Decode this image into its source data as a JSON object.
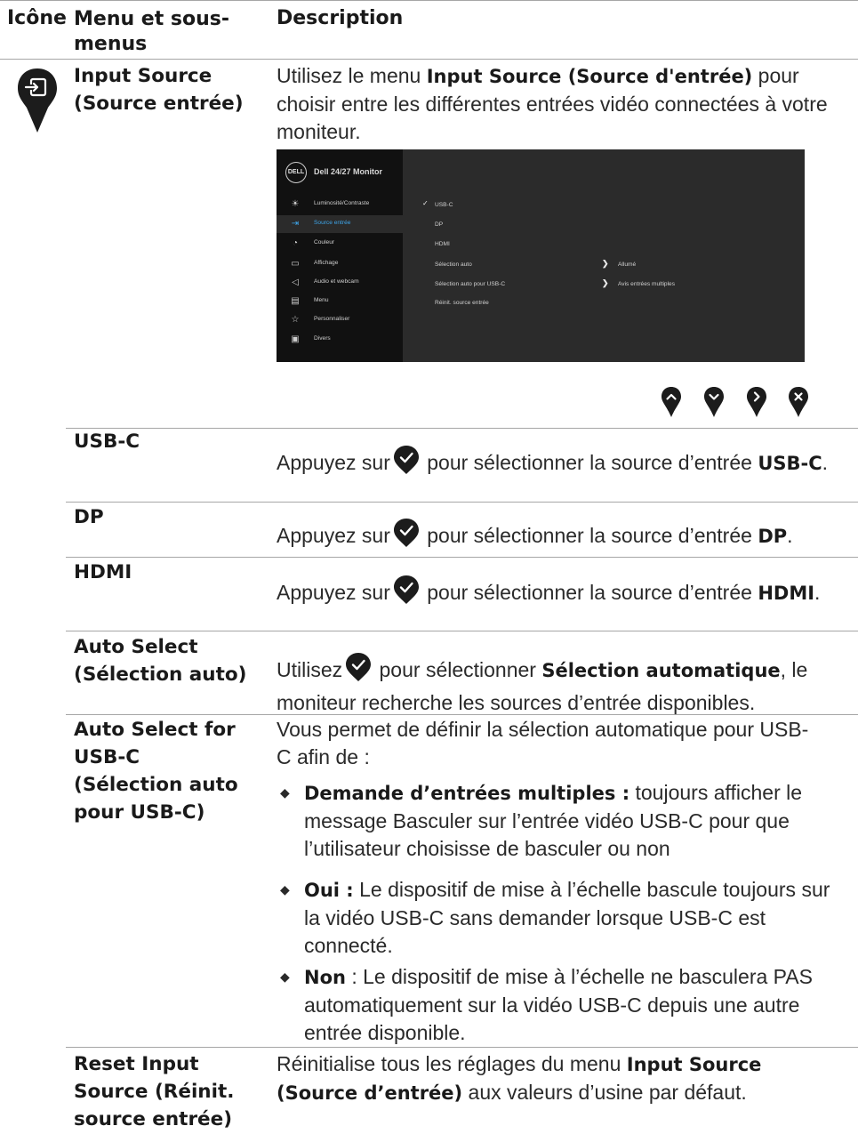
{
  "header": {
    "icon": "Icône",
    "menu": "Menu et sous-menus",
    "description": "Description"
  },
  "input_source": {
    "icon_name": "input-source-icon",
    "menu": "Input Source (Source entrée)",
    "desc_pre": "Utilisez le menu ",
    "desc_bold": "Input Source (Source d'entrée)",
    "desc_post": " pour choisir entre les différentes entrées vidéo connectées à votre moniteur."
  },
  "osd": {
    "logo": "DELL",
    "title": "Dell 24/27 Monitor",
    "menu_items": [
      {
        "icon": "brightness-icon",
        "label": "Luminosité/Contraste"
      },
      {
        "icon": "input-source-icon",
        "label": "Source entrée"
      },
      {
        "icon": "color-icon",
        "label": "Couleur"
      },
      {
        "icon": "display-icon",
        "label": "Affichage"
      },
      {
        "icon": "audio-icon",
        "label": "Audio et webcam"
      },
      {
        "icon": "menu-icon",
        "label": "Menu"
      },
      {
        "icon": "star-icon",
        "label": "Personnaliser"
      },
      {
        "icon": "others-icon",
        "label": "Divers"
      }
    ],
    "selected_item": "Source entrée",
    "options": [
      {
        "label": "USB-C",
        "checked": true
      },
      {
        "label": "DP"
      },
      {
        "label": "HDMI"
      },
      {
        "label": "Sélection auto",
        "value": "Allumé"
      },
      {
        "label": "Sélection auto pour USB-C",
        "value": "Avis entrées multiples"
      },
      {
        "label": "Réinit. source entrée"
      }
    ]
  },
  "joystick_icons": [
    "up-icon",
    "down-icon",
    "right-icon",
    "close-icon"
  ],
  "rows": {
    "usbc": {
      "menu": "USB-C",
      "pre": "Appuyez sur",
      "mid": " pour sélectionner la source d’entrée ",
      "bold": "USB-C",
      "post": "."
    },
    "dp": {
      "menu": "DP",
      "pre": "Appuyez sur",
      "mid": " pour sélectionner la source d’entrée ",
      "bold": "DP",
      "post": "."
    },
    "hdmi": {
      "menu": "HDMI",
      "pre": "Appuyez sur",
      "mid": " pour sélectionner la source d’entrée ",
      "bold": "HDMI",
      "post": "."
    },
    "auto": {
      "menu": "Auto Select (Sélection auto)",
      "pre": "Utilisez",
      "mid": " pour sélectionner ",
      "bold": "Sélection automatique",
      "post": ", le moniteur recherche les sources d’entrée disponibles."
    },
    "auto_usbc": {
      "menu": "Auto Select for USB-C (Sélection auto pour USB-C)",
      "intro": "Vous permet de définir la sélection automatique pour USB-C afin de :",
      "bullets": [
        {
          "bold": "Demande d’entrées multiples :",
          "text": " toujours afficher le message Basculer sur l’entrée vidéo USB-C pour que l’utilisateur choisisse de basculer ou non"
        },
        {
          "bold": "Oui :",
          "text": " Le dispositif de mise à l’échelle bascule toujours sur la vidéo USB-C sans demander lorsque USB-C est connecté."
        },
        {
          "bold": "Non",
          "text": " : Le dispositif de mise à l’échelle ne basculera PAS automatiquement sur la vidéo USB-C depuis une autre entrée disponible."
        }
      ]
    },
    "reset": {
      "menu": "Reset Input Source (Réinit. source entrée)",
      "pre": "Réinitialise tous les réglages du menu ",
      "bold": "Input Source (Source d’entrée)",
      "post": " aux valeurs d’usine par défaut."
    }
  },
  "colors": {
    "text": "#1a1a1a",
    "osd_bg": "#2b2b2b",
    "osd_side": "#111111",
    "osd_accent": "#3ea6ea"
  }
}
